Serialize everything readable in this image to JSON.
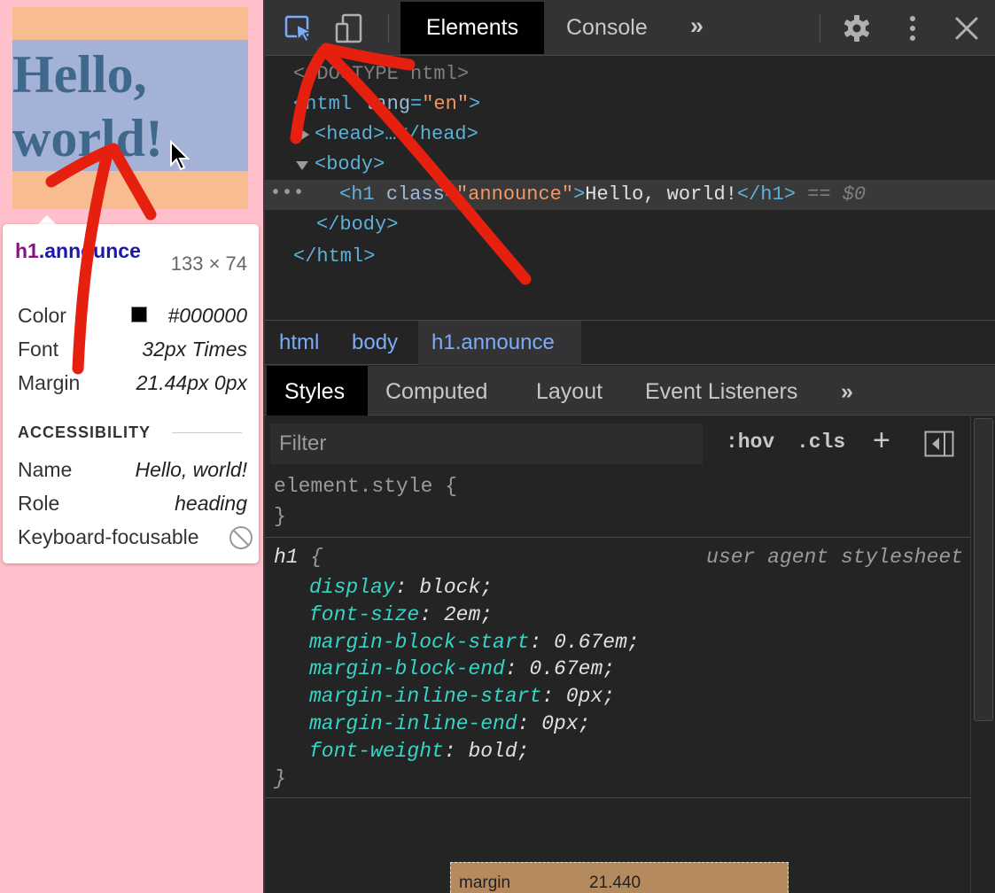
{
  "preview": {
    "heading_text": "Hello,\nworld!"
  },
  "tooltip": {
    "selector_tag": "h1",
    "selector_class": ".announce",
    "size": "133 × 74",
    "rows": [
      {
        "label": "Color",
        "value": "#000000"
      },
      {
        "label": "Font",
        "value": "32px Times"
      },
      {
        "label": "Margin",
        "value": "21.44px 0px"
      }
    ],
    "accessibility_title": "ACCESSIBILITY",
    "acc_rows": [
      {
        "label": "Name",
        "value": "Hello, world!"
      },
      {
        "label": "Role",
        "value": "heading"
      },
      {
        "label": "Keyboard-focusable",
        "value": ""
      }
    ],
    "color_swatch": "#000000"
  },
  "toolbar": {
    "inspect_icon": "inspect-element-icon",
    "device_icon": "device-toolbar-icon",
    "tabs": [
      "Elements",
      "Console"
    ],
    "more": "»",
    "settings_icon": "gear-icon",
    "menu_icon": "kebab-menu-icon",
    "close_icon": "close-icon",
    "accent": "#7cacf8"
  },
  "dom": {
    "doctype": "<!DOCTYPE html>",
    "html_open_tag": "<html",
    "html_attr": "lang",
    "html_attr_value": "\"en\"",
    "head_line": "<head>…</head>",
    "body_open": "<body>",
    "h1_open": "<h1",
    "h1_attr": "class",
    "h1_attr_value": "\"announce\"",
    "h1_text": "Hello, world!",
    "h1_close": "</h1>",
    "h1_marker": "== $0",
    "body_close": "</body>",
    "html_close": "</html>",
    "ellipsis": "•••"
  },
  "breadcrumbs": [
    "html",
    "body",
    "h1.announce"
  ],
  "subtabs": [
    "Styles",
    "Computed",
    "Layout",
    "Event Listeners"
  ],
  "subtabs_more": "»",
  "filter": {
    "placeholder": "Filter",
    "hov": ":hov",
    "cls": ".cls",
    "plus": "+"
  },
  "styles": {
    "element_style_open": "element.style {",
    "element_style_close": "}",
    "h1_selector": "h1",
    "h1_brace_open": " {",
    "source": "user agent stylesheet",
    "declarations": [
      {
        "prop": "display",
        "value": "block"
      },
      {
        "prop": "font-size",
        "value": "2em"
      },
      {
        "prop": "margin-block-start",
        "value": "0.67em"
      },
      {
        "prop": "margin-block-end",
        "value": "0.67em"
      },
      {
        "prop": "margin-inline-start",
        "value": "0px"
      },
      {
        "prop": "margin-inline-end",
        "value": "0px"
      },
      {
        "prop": "font-weight",
        "value": "bold"
      }
    ],
    "h1_brace_close": "}"
  },
  "box_model": {
    "label": "margin",
    "value": "21.440"
  }
}
